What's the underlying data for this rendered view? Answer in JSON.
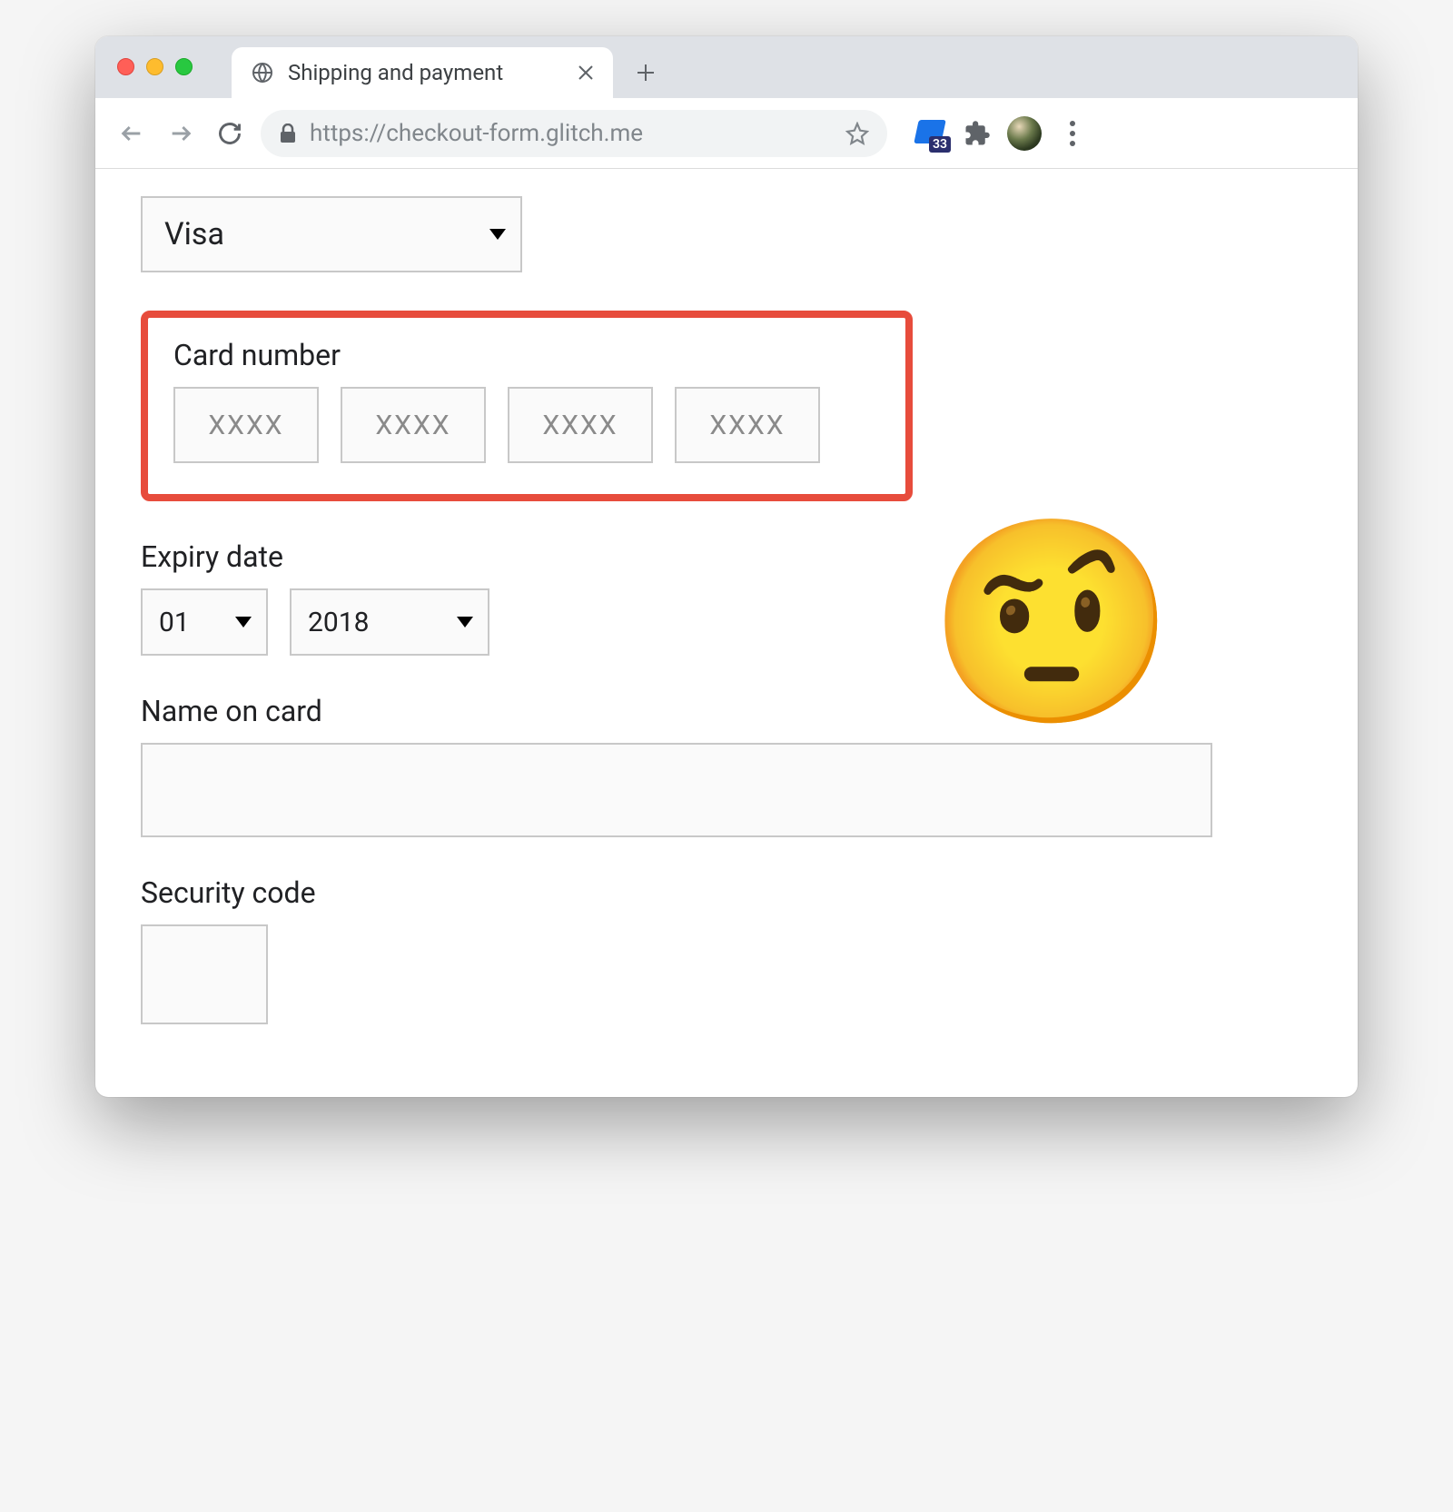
{
  "browser": {
    "tab_title": "Shipping and payment",
    "url": "https://checkout-form.glitch.me",
    "extension_badge_count": "33"
  },
  "form": {
    "card_type": {
      "selected": "Visa"
    },
    "card_number": {
      "label": "Card number",
      "segment_placeholder": "XXXX"
    },
    "expiry": {
      "label": "Expiry date",
      "month_selected": "01",
      "year_selected": "2018"
    },
    "name": {
      "label": "Name on card",
      "value": ""
    },
    "cvv": {
      "label": "Security code",
      "value": ""
    }
  },
  "annotation": {
    "emoji": "🤨"
  }
}
